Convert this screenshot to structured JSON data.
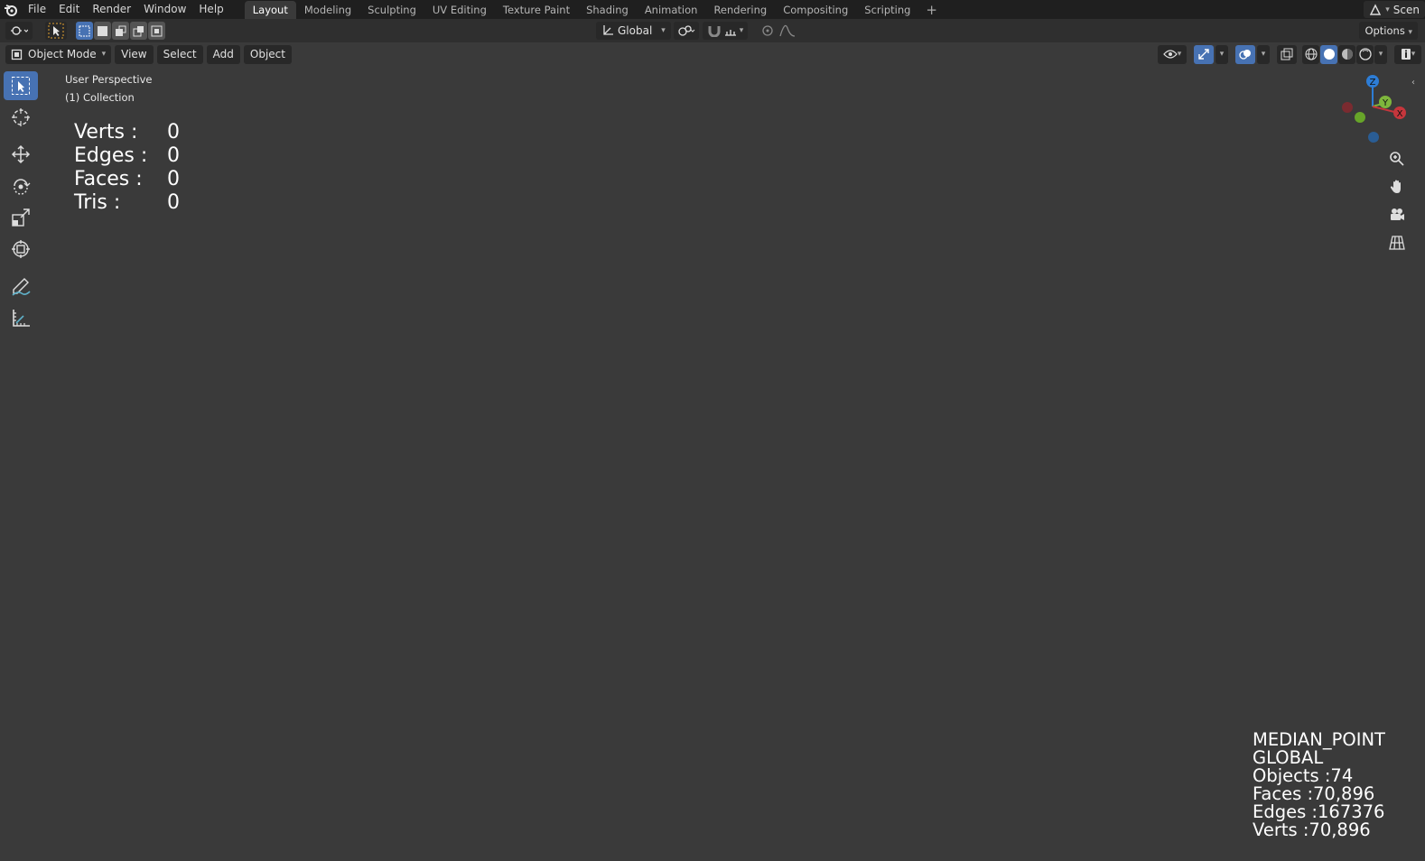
{
  "menubar": {
    "items": [
      "File",
      "Edit",
      "Render",
      "Window",
      "Help"
    ],
    "workspaces": [
      "Layout",
      "Modeling",
      "Sculpting",
      "UV Editing",
      "Texture Paint",
      "Shading",
      "Animation",
      "Rendering",
      "Compositing",
      "Scripting"
    ],
    "active_workspace": "Layout",
    "add_tab": "+",
    "scene_label": "Scen"
  },
  "tool_header": {
    "orientation": "Global",
    "options_label": "Options"
  },
  "viewport_header": {
    "mode": "Object Mode",
    "menus": [
      "View",
      "Select",
      "Add",
      "Object"
    ]
  },
  "viewport": {
    "view_name": "User Perspective",
    "collection": "(1) Collection",
    "stats": [
      {
        "label": "Verts :",
        "value": "0"
      },
      {
        "label": "Edges :",
        "value": "0"
      },
      {
        "label": "Faces :",
        "value": "0"
      },
      {
        "label": "Tris :",
        "value": "0"
      }
    ],
    "overlay_lines": [
      "MEDIAN_POINT",
      "GLOBAL",
      "Objects :74",
      "Faces :70,896",
      "Edges :167376",
      "Verts :70,896"
    ],
    "gizmo_axes": [
      "Z",
      "Y",
      "X"
    ]
  },
  "colors": {
    "accent": "#4772b3",
    "model_red": "#9c0e14",
    "x_axis": "#c6363c",
    "y_axis": "#7eb63c",
    "z_axis": "#2d7dd6"
  }
}
